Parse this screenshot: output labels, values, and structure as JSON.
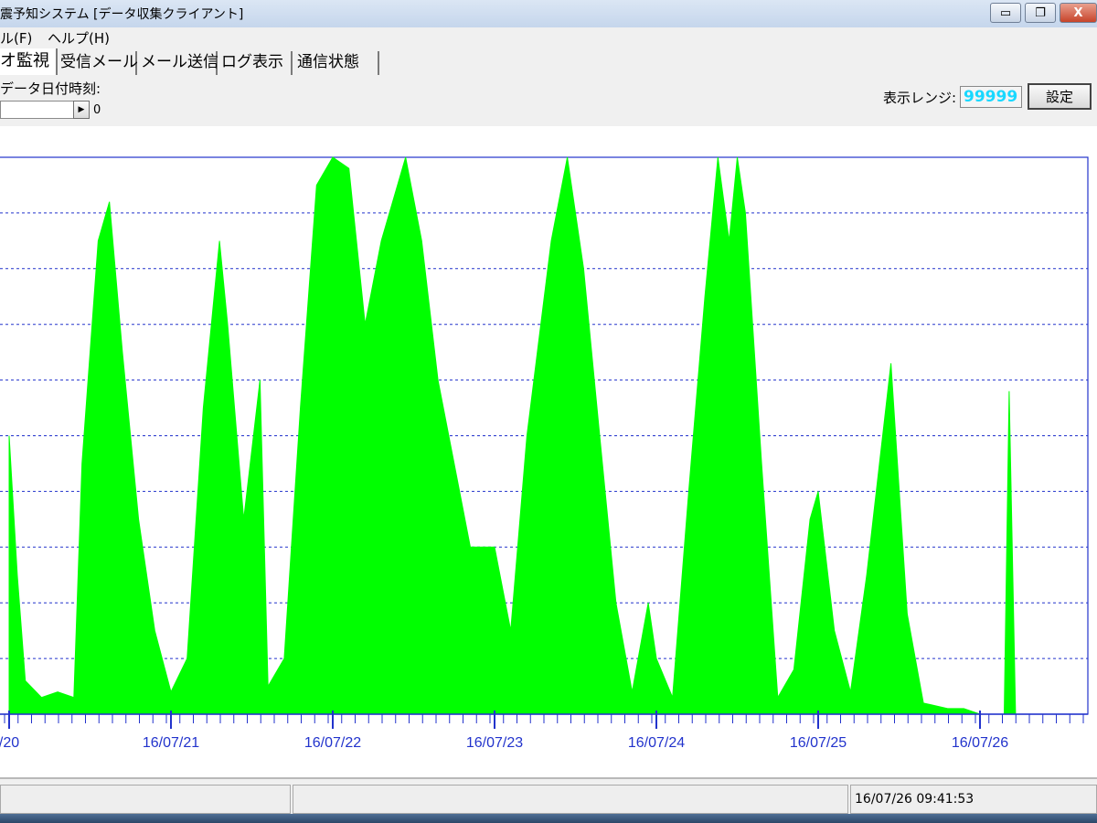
{
  "window": {
    "title": "震予知システム [データ収集クライアント]",
    "buttons": {
      "minimize": "▭",
      "restore": "❐",
      "close": "X"
    }
  },
  "menu": [
    "ル(F)",
    "ヘルプ(H)"
  ],
  "tabs": [
    "オ監視",
    "受信メール",
    "メール送信",
    "ログ表示",
    "通信状態"
  ],
  "controls": {
    "datetime_label": "データ日付時刻:",
    "slider_value": "0",
    "range_label": "表示レンジ:",
    "range_value": "99999",
    "set_button": "設定"
  },
  "chart_data": {
    "type": "area",
    "x_ticks": [
      "/20",
      "16/07/21",
      "16/07/22",
      "16/07/23",
      "16/07/24",
      "16/07/25",
      "16/07/26"
    ],
    "ylim": [
      0,
      10
    ],
    "gridlines": "dashed horizontal, 9",
    "series": [
      {
        "color": "#00ff00",
        "description_points": [
          [
            0.0,
            5.0
          ],
          [
            0.05,
            2.5
          ],
          [
            0.1,
            0.6
          ],
          [
            0.2,
            0.3
          ],
          [
            0.3,
            0.4
          ],
          [
            0.4,
            0.3
          ],
          [
            0.45,
            4.5
          ],
          [
            0.55,
            8.5
          ],
          [
            0.62,
            9.2
          ],
          [
            0.7,
            6.5
          ],
          [
            0.8,
            3.5
          ],
          [
            0.9,
            1.5
          ],
          [
            1.0,
            0.4
          ],
          [
            1.1,
            1.0
          ],
          [
            1.2,
            5.5
          ],
          [
            1.3,
            8.5
          ],
          [
            1.35,
            7.0
          ],
          [
            1.45,
            3.5
          ],
          [
            1.55,
            6.0
          ],
          [
            1.6,
            0.5
          ],
          [
            1.7,
            1.0
          ],
          [
            1.8,
            5.5
          ],
          [
            1.9,
            9.5
          ],
          [
            2.0,
            10.0
          ],
          [
            2.1,
            9.8
          ],
          [
            2.2,
            7.0
          ],
          [
            2.3,
            8.5
          ],
          [
            2.45,
            10.0
          ],
          [
            2.55,
            8.5
          ],
          [
            2.65,
            6.0
          ],
          [
            2.75,
            4.5
          ],
          [
            2.85,
            3.0
          ],
          [
            3.0,
            3.0
          ],
          [
            3.1,
            1.5
          ],
          [
            3.2,
            5.0
          ],
          [
            3.35,
            8.5
          ],
          [
            3.45,
            10.0
          ],
          [
            3.55,
            8.0
          ],
          [
            3.65,
            5.0
          ],
          [
            3.75,
            2.0
          ],
          [
            3.85,
            0.4
          ],
          [
            3.95,
            2.0
          ],
          [
            4.0,
            1.0
          ],
          [
            4.1,
            0.3
          ],
          [
            4.2,
            4.0
          ],
          [
            4.3,
            7.5
          ],
          [
            4.38,
            10.0
          ],
          [
            4.45,
            8.5
          ],
          [
            4.5,
            10.0
          ],
          [
            4.55,
            9.0
          ],
          [
            4.65,
            4.5
          ],
          [
            4.75,
            0.3
          ],
          [
            4.85,
            0.8
          ],
          [
            4.95,
            3.5
          ],
          [
            5.0,
            4.0
          ],
          [
            5.1,
            1.5
          ],
          [
            5.2,
            0.4
          ],
          [
            5.3,
            2.5
          ],
          [
            5.45,
            6.3
          ],
          [
            5.55,
            1.8
          ],
          [
            5.65,
            0.2
          ],
          [
            5.8,
            0.1
          ],
          [
            5.9,
            0.1
          ],
          [
            6.0,
            0.0
          ],
          [
            6.15,
            0.0
          ],
          [
            6.18,
            5.8
          ],
          [
            6.22,
            0.0
          ],
          [
            6.5,
            0.0
          ]
        ]
      }
    ]
  },
  "status": {
    "panels": [
      "",
      "",
      "16/07/26 09:41:53"
    ]
  }
}
